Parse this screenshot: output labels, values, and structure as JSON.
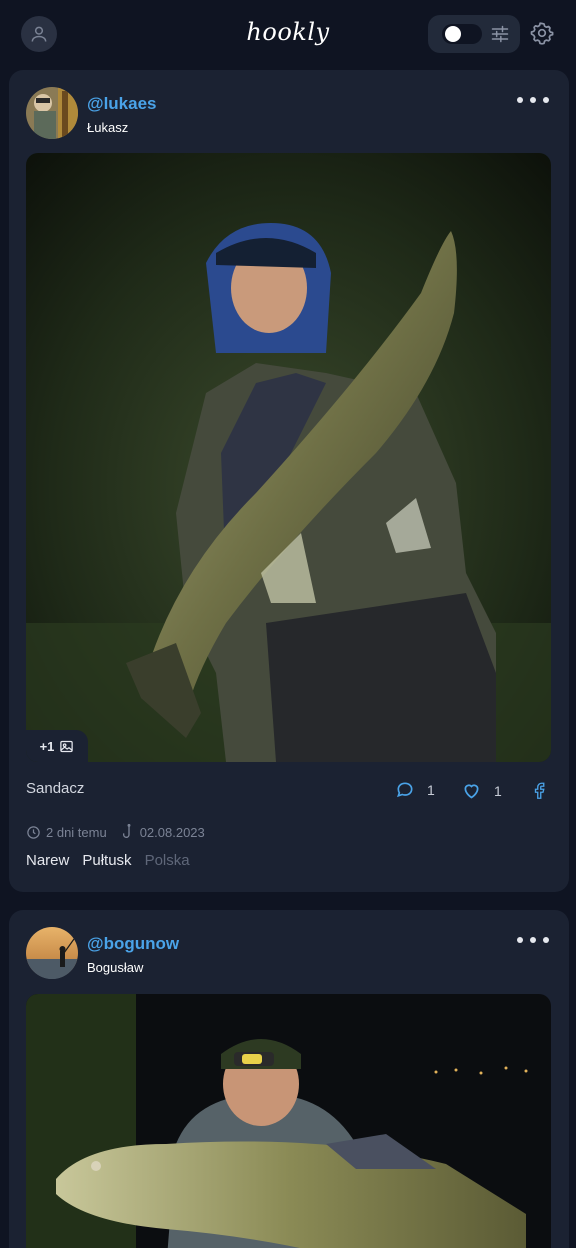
{
  "app": {
    "logo": "hookly"
  },
  "header": {
    "profile_icon": "user-icon",
    "theme_switch": "toggle-switch",
    "filter_icon": "sliders-icon",
    "settings_icon": "gear-icon"
  },
  "posts": [
    {
      "username": "@lukaes",
      "display_name": "Łukasz",
      "photo_count_badge": "+1",
      "species": "Sandacz",
      "comments": "1",
      "likes": "1",
      "time_ago": "2 dni temu",
      "catch_date": "02.08.2023",
      "river": "Narew",
      "city": "Pułtusk",
      "country": "Polska"
    },
    {
      "username": "@bogunow",
      "display_name": "Bogusław"
    }
  ],
  "colors": {
    "background": "#0f1422",
    "card": "#1b2232",
    "accent": "#4aa3e8",
    "muted": "#7b8395"
  }
}
